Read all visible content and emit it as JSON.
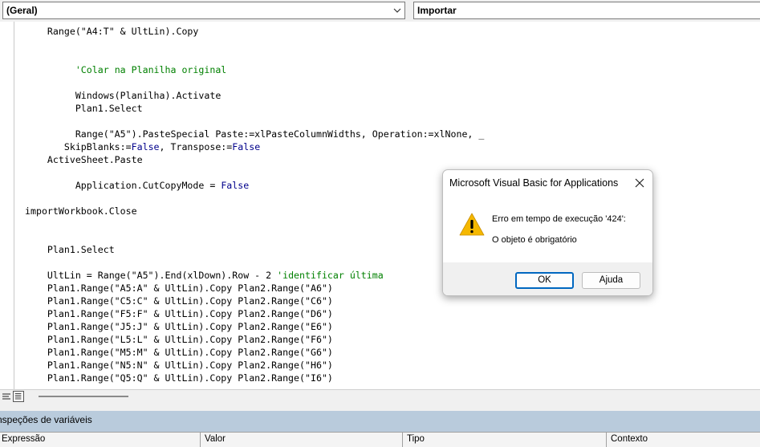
{
  "toolbar": {
    "object_combo": "(Geral)",
    "procedure_combo": "Importar"
  },
  "code_lines": [
    [
      {
        "t": "    Range(\"A4:T\" & UltLin).Copy",
        "c": ""
      }
    ],
    [
      {
        "t": "",
        "c": ""
      }
    ],
    [
      {
        "t": "",
        "c": ""
      }
    ],
    [
      {
        "t": "         ",
        "c": ""
      },
      {
        "t": "'Colar na Planilha original",
        "c": "cm"
      }
    ],
    [
      {
        "t": "",
        "c": ""
      }
    ],
    [
      {
        "t": "         Windows(Planilha).Activate",
        "c": ""
      }
    ],
    [
      {
        "t": "         Plan1.Select",
        "c": ""
      }
    ],
    [
      {
        "t": "",
        "c": ""
      }
    ],
    [
      {
        "t": "         Range(\"A5\").PasteSpecial Paste:=xlPasteColumnWidths, Operation:=xlNone, _",
        "c": ""
      }
    ],
    [
      {
        "t": "       SkipBlanks:=",
        "c": ""
      },
      {
        "t": "False",
        "c": "kw"
      },
      {
        "t": ", Transpose:=",
        "c": ""
      },
      {
        "t": "False",
        "c": "kw"
      }
    ],
    [
      {
        "t": "    ActiveSheet.Paste",
        "c": ""
      }
    ],
    [
      {
        "t": "",
        "c": ""
      }
    ],
    [
      {
        "t": "         Application.CutCopyMode = ",
        "c": ""
      },
      {
        "t": "False",
        "c": "kw"
      }
    ],
    [
      {
        "t": "",
        "c": ""
      }
    ],
    [
      {
        "t": "importWorkbook.Close",
        "c": ""
      }
    ],
    [
      {
        "t": "",
        "c": ""
      }
    ],
    [
      {
        "t": "",
        "c": ""
      }
    ],
    [
      {
        "t": "    Plan1.Select",
        "c": ""
      }
    ],
    [
      {
        "t": "",
        "c": ""
      }
    ],
    [
      {
        "t": "    UltLin = Range(\"A5\").End(xlDown).Row - 2 ",
        "c": ""
      },
      {
        "t": "'identificar última",
        "c": "cm"
      }
    ],
    [
      {
        "t": "    Plan1.Range(\"A5:A\" & UltLin).Copy Plan2.Range(\"A6\")",
        "c": ""
      }
    ],
    [
      {
        "t": "    Plan1.Range(\"C5:C\" & UltLin).Copy Plan2.Range(\"C6\")",
        "c": ""
      }
    ],
    [
      {
        "t": "    Plan1.Range(\"F5:F\" & UltLin).Copy Plan2.Range(\"D6\")",
        "c": ""
      }
    ],
    [
      {
        "t": "    Plan1.Range(\"J5:J\" & UltLin).Copy Plan2.Range(\"E6\")",
        "c": ""
      }
    ],
    [
      {
        "t": "    Plan1.Range(\"L5:L\" & UltLin).Copy Plan2.Range(\"F6\")",
        "c": ""
      }
    ],
    [
      {
        "t": "    Plan1.Range(\"M5:M\" & UltLin).Copy Plan2.Range(\"G6\")",
        "c": ""
      }
    ],
    [
      {
        "t": "    Plan1.Range(\"N5:N\" & UltLin).Copy Plan2.Range(\"H6\")",
        "c": ""
      }
    ],
    [
      {
        "t": "    Plan1.Range(\"Q5:Q\" & UltLin).Copy Plan2.Range(\"I6\")",
        "c": ""
      }
    ]
  ],
  "watch": {
    "title": "nspeções de variáveis",
    "columns": [
      "Expressão",
      "Valor",
      "Tipo",
      "Contexto"
    ]
  },
  "dialog": {
    "title": "Microsoft Visual Basic for Applications",
    "message_line1": "Erro em tempo de execução '424':",
    "message_line2": "O objeto é obrigatório",
    "ok_label": "OK",
    "help_label": "Ajuda",
    "icon": "warning-icon"
  },
  "colors": {
    "keyword": "#00008b",
    "comment": "#008000",
    "watch_title_bg": "#b9cbdc",
    "ok_border": "#0067c0",
    "warning": "#f5b800"
  }
}
